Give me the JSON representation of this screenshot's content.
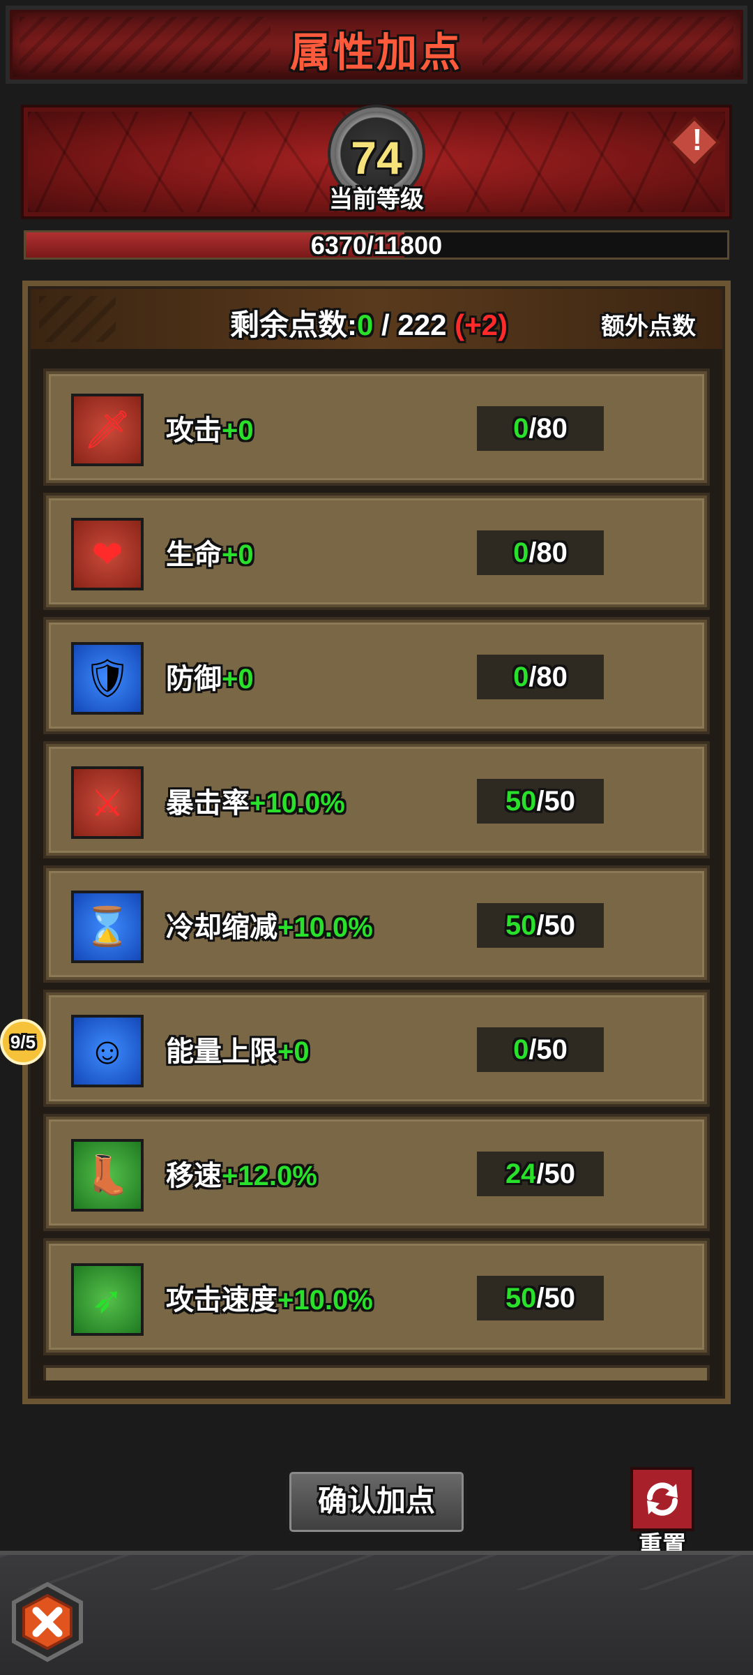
{
  "header": {
    "title": "属性加点"
  },
  "level": {
    "value": "74",
    "label": "当前等级"
  },
  "experience": {
    "text": "6370/11800",
    "current": 6370,
    "max": 11800
  },
  "points": {
    "label": "剩余点数:",
    "remaining": "0",
    "separator": " / ",
    "total": "222",
    "bonus": "(+2)",
    "extra_label": "额外点数"
  },
  "attributes": [
    {
      "name": "攻击",
      "bonus": "+0",
      "current": "0",
      "max": "/80",
      "icon": "sword-icon",
      "color": "red"
    },
    {
      "name": "生命",
      "bonus": "+0",
      "current": "0",
      "max": "/80",
      "icon": "heart-icon",
      "color": "red"
    },
    {
      "name": "防御",
      "bonus": "+0",
      "current": "0",
      "max": "/80",
      "icon": "shield-icon",
      "color": "blue"
    },
    {
      "name": "暴击率",
      "bonus": "+10.0%",
      "current": "50",
      "max": "/50",
      "icon": "crit-sword-icon",
      "color": "red"
    },
    {
      "name": "冷却缩减",
      "bonus": "+10.0%",
      "current": "50",
      "max": "/50",
      "icon": "hourglass-icon",
      "color": "blue"
    },
    {
      "name": "能量上限",
      "bonus": "+0",
      "current": "0",
      "max": "/50",
      "icon": "energy-figure-icon",
      "color": "blue"
    },
    {
      "name": "移速",
      "bonus": "+12.0%",
      "current": "24",
      "max": "/50",
      "icon": "boot-icon",
      "color": "green"
    },
    {
      "name": "攻击速度",
      "bonus": "+10.0%",
      "current": "50",
      "max": "/50",
      "icon": "attack-speed-arrow-icon",
      "color": "green"
    }
  ],
  "side_badge": {
    "text": "9/5"
  },
  "buttons": {
    "confirm": "确认加点",
    "reset": "重置"
  },
  "colors": {
    "accent_green": "#29e02a",
    "accent_red": "#ff2b2b",
    "title_red": "#ff5a3c",
    "level_yellow": "#f6e27a"
  }
}
